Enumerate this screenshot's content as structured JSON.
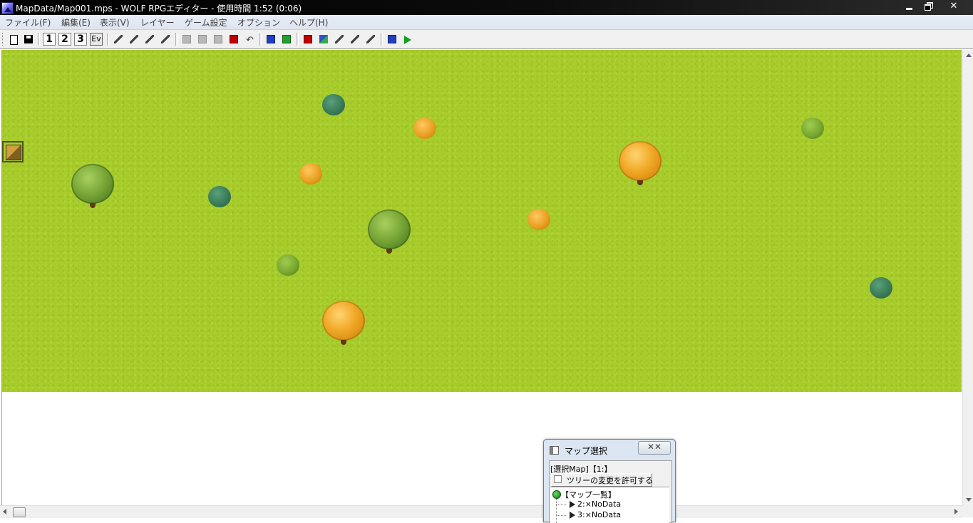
{
  "window": {
    "title": "MapData/Map001.mps - WOLF RPGエディター - 使用時間 1:52 (0:06)",
    "minimize_label": "",
    "close_label": "✕"
  },
  "menu": [
    "ファイル(F)",
    "編集(E)",
    "表示(V)",
    "レイヤー",
    "ゲーム設定",
    "オプション",
    "ヘルプ(H)"
  ],
  "toolbar": {
    "icons": [
      "new-map-icon",
      "save-icon",
      "layer-1-icon",
      "layer-2-icon",
      "layer-3-icon",
      "event-layer-icon",
      "autotile-1-icon",
      "autotile-2-icon",
      "autotile-3-icon",
      "autotile-4-icon",
      "pencil-icon",
      "rectangle-fill-icon",
      "fill-icon",
      "copy-icon",
      "undo-icon",
      "map-settings-icon",
      "tileset-icon",
      "database-icon",
      "common-event-icon",
      "tools-icon",
      "search-icon",
      "map-bgm-icon",
      "script-icon",
      "play-test-icon"
    ],
    "layer_labels": [
      "1",
      "2",
      "3",
      "Ev"
    ]
  },
  "map": {
    "tile_color": "#a8cc2c",
    "background_color": "#ffffff",
    "trees": [
      {
        "kind": "teal-small",
        "name": "teal-bush"
      },
      {
        "kind": "orange-small",
        "name": "orange-bush"
      },
      {
        "kind": "lime-small",
        "name": "lime-bush"
      },
      {
        "kind": "orange-large",
        "name": "orange-tree"
      },
      {
        "kind": "green-large",
        "name": "green-tree"
      },
      {
        "kind": "orange-small",
        "name": "orange-bush"
      },
      {
        "kind": "teal-small",
        "name": "teal-bush"
      },
      {
        "kind": "green-large",
        "name": "green-tree"
      },
      {
        "kind": "orange-small",
        "name": "orange-bush"
      },
      {
        "kind": "lime-small",
        "name": "lime-bush"
      },
      {
        "kind": "teal-small",
        "name": "teal-bush"
      },
      {
        "kind": "orange-large",
        "name": "orange-tree"
      }
    ]
  },
  "map_select_panel": {
    "title": "マップ選択",
    "close_label": "✕✕",
    "selected_map": "[選択Map]【1:】",
    "allow_tree_change_label": "ツリーの変更を許可する",
    "allow_tree_change_checked": false,
    "root_label": "【マップ一覧】",
    "items": [
      "2:×NoData",
      "3:×NoData"
    ]
  }
}
